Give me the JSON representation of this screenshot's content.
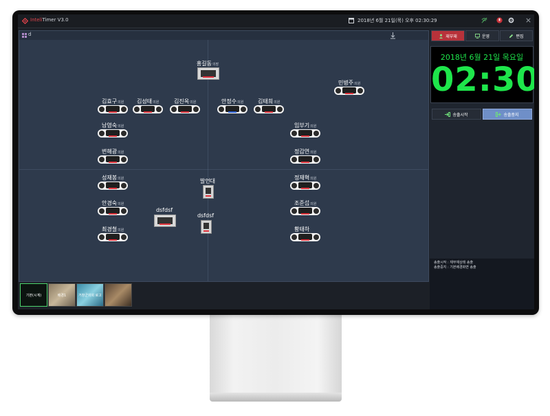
{
  "app": {
    "title_prefix": "Inteli",
    "title_rest": "Timer V3.0",
    "datetime": "2018년 6월 21일(목) 오후 02:30:29",
    "icons": [
      "wifi-off-icon",
      "record-icon",
      "gear-icon",
      "close-icon"
    ]
  },
  "canvas": {
    "label": "d",
    "download_icon": "download-icon"
  },
  "seats": [
    {
      "name": "홍길동",
      "role": "의장",
      "type": "podium"
    },
    {
      "name": "민병주",
      "role": "의원",
      "type": "seat"
    },
    {
      "name": "김효구",
      "role": "의원",
      "type": "seat"
    },
    {
      "name": "김성태",
      "role": "의원",
      "type": "seat"
    },
    {
      "name": "김진옥",
      "role": "의원",
      "type": "seat"
    },
    {
      "name": "안정수",
      "role": "의원",
      "type": "seat",
      "active": true
    },
    {
      "name": "김태희",
      "role": "의원",
      "type": "seat"
    },
    {
      "name": "남영숙",
      "role": "의원",
      "type": "seat"
    },
    {
      "name": "임부기",
      "role": "의원",
      "type": "seat"
    },
    {
      "name": "변해광",
      "role": "의원",
      "type": "seat"
    },
    {
      "name": "정갑연",
      "role": "의원",
      "type": "seat"
    },
    {
      "name": "성재봉",
      "role": "의원",
      "type": "seat"
    },
    {
      "name": "정재혁",
      "role": "의원",
      "type": "seat"
    },
    {
      "name": "안경숙",
      "role": "의원",
      "type": "seat"
    },
    {
      "name": "조준섭",
      "role": "의원",
      "type": "seat"
    },
    {
      "name": "최경철",
      "role": "의원",
      "type": "seat"
    },
    {
      "name": "황태하",
      "role": "",
      "type": "seat"
    },
    {
      "name": "발언대",
      "role": "",
      "type": "stand"
    },
    {
      "name": "dsfdsf",
      "role": "",
      "type": "podium"
    },
    {
      "name": "dsfdsf",
      "role": "",
      "type": "stand"
    }
  ],
  "thumbnails": [
    {
      "label": "기본(시계)",
      "selected": true
    },
    {
      "label": "배경1",
      "selected": false
    },
    {
      "label": "거창군의회 로고",
      "selected": false
    },
    {
      "label": "",
      "selected": false
    }
  ],
  "tabs": [
    {
      "label": "재부재",
      "active": true,
      "icon": "person-icon"
    },
    {
      "label": "운영",
      "active": false,
      "icon": "monitor-icon"
    },
    {
      "label": "편집",
      "active": false,
      "icon": "edit-icon"
    }
  ],
  "clock": {
    "date": "2018년 6월 21일 목요일",
    "time": "02:30"
  },
  "broadcast": {
    "start_label": "송출시작",
    "stop_label": "송출중지"
  },
  "log": [
    "송출시작 : 재부재상태 송출",
    "송출중지 : 기본배경화면 송출"
  ],
  "colors": {
    "accent_red": "#e0434b",
    "clock_green": "#1ee64b",
    "active_tab": "#b8323a",
    "stop_button": "#6f8fc8"
  }
}
